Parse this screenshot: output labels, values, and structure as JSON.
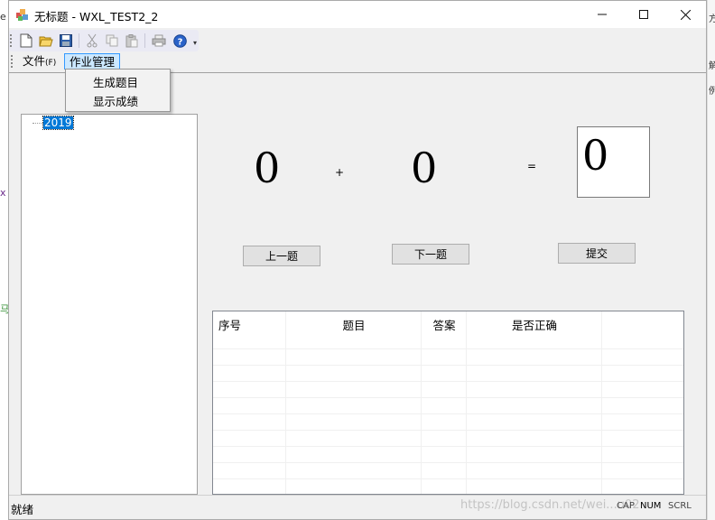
{
  "window": {
    "title": "无标题 - WXL_TEST2_2"
  },
  "toolbar": {
    "buttons": [
      {
        "icon": "new-file-icon",
        "enabled": true
      },
      {
        "icon": "open-folder-icon",
        "enabled": true
      },
      {
        "icon": "save-icon",
        "enabled": true
      },
      {
        "icon": "cut-icon",
        "enabled": false
      },
      {
        "icon": "copy-icon",
        "enabled": false
      },
      {
        "icon": "paste-icon",
        "enabled": false
      },
      {
        "icon": "print-icon",
        "enabled": false
      },
      {
        "icon": "help-icon",
        "enabled": true
      }
    ]
  },
  "menu": {
    "file": {
      "label": "文件",
      "accel": "(F)"
    },
    "homework": {
      "label": "作业管理"
    },
    "dropdown": [
      "生成题目",
      "显示成绩"
    ]
  },
  "tree": {
    "node": "2019"
  },
  "quiz": {
    "left_operand": "0",
    "operator": "+",
    "right_operand": "0",
    "equals": "=",
    "answer": "0",
    "prev_button": "上一题",
    "next_button": "下一题",
    "submit_button": "提交"
  },
  "grid": {
    "headers": [
      "序号",
      "题目",
      "答案",
      "是否正确"
    ]
  },
  "status": {
    "text": "就绪",
    "indicators": [
      "CAP",
      "NUM",
      "SCRL"
    ],
    "watermark": "https://blog.csdn.net/wei...u02"
  },
  "side_fragments": {
    "left": [
      "e",
      "x",
      "马"
    ],
    "right": [
      "方",
      "解",
      "例"
    ]
  },
  "colors": {
    "selection": "#0078d7",
    "menu_highlight": "#cce8ff",
    "menu_highlight_border": "#3399ff",
    "window_bg": "#f0f0f0"
  }
}
